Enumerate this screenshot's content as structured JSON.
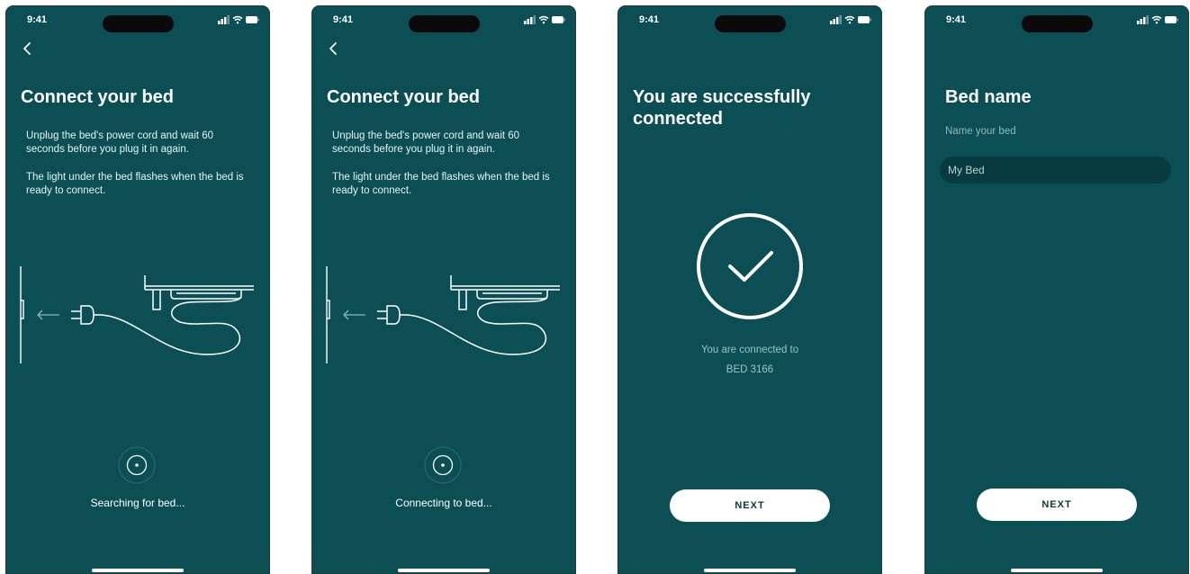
{
  "status_bar": {
    "time": "9:41"
  },
  "screens": [
    {
      "title": "Connect your bed",
      "instructions": [
        "Unplug the bed's power cord and wait 60 seconds before you plug it in again.",
        "The light under the bed flashes when the bed is ready to connect."
      ],
      "status": "Searching for bed..."
    },
    {
      "title": "Connect your bed",
      "instructions": [
        "Unplug the bed's power cord and wait 60 seconds before you plug it in again.",
        "The light under the bed flashes when the bed is ready to connect."
      ],
      "status": "Connecting to bed..."
    },
    {
      "title": "You are successfully connected",
      "connected_label": "You are connected to",
      "bed_id": "BED 3166",
      "next_label": "NEXT"
    },
    {
      "title": "Bed name",
      "subtitle": "Name your bed",
      "name_value": "My Bed",
      "next_label": "NEXT"
    }
  ],
  "icons": {
    "back": "chevron-left-icon",
    "signal": "cellular-signal-icon",
    "wifi": "wifi-icon",
    "battery": "battery-icon",
    "plug": "power-plug-icon",
    "bed": "bed-icon",
    "wall_outlet": "wall-outlet-icon",
    "arrow": "arrow-left-icon",
    "spinner": "target-spinner-icon",
    "check": "checkmark-circle-icon"
  },
  "colors": {
    "background": "#0b4f55",
    "button": "#ffffff",
    "muted_text": "#93b9b9"
  }
}
